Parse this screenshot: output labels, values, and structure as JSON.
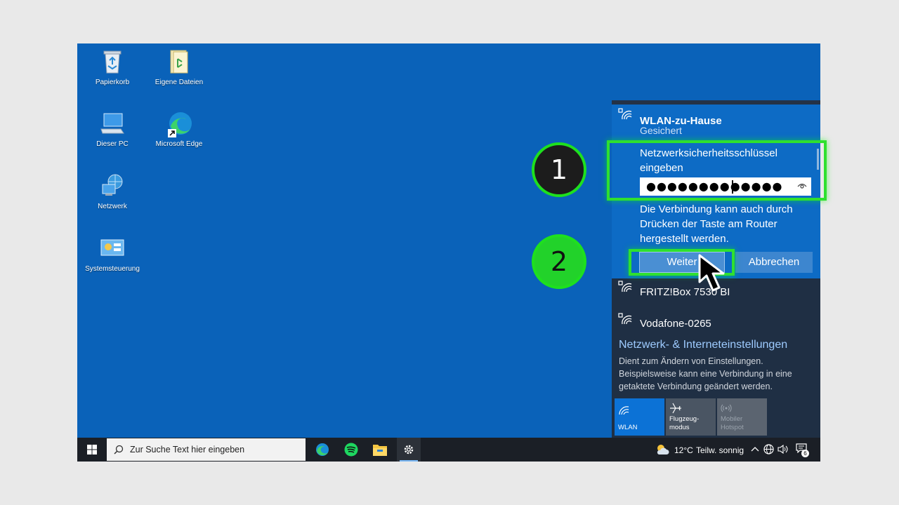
{
  "desktop": {
    "icons": [
      {
        "label": "Papierkorb",
        "icon": "recycle-bin-icon"
      },
      {
        "label": "Eigene Dateien",
        "icon": "user-folder-icon"
      },
      {
        "label": "Dieser PC",
        "icon": "computer-icon"
      },
      {
        "label": "Microsoft Edge",
        "icon": "edge-icon"
      },
      {
        "label": "Netzwerk",
        "icon": "network-icon"
      },
      {
        "label": "Systemsteuerung",
        "icon": "control-panel-icon"
      }
    ]
  },
  "flyout": {
    "selected": {
      "name": "WLAN-zu-Hause",
      "status": "Gesichert",
      "prompt_line1": "Netzwerksicherheitsschlüssel",
      "prompt_line2": "eingeben",
      "password_mask": "●●●●●●●●●●●●●",
      "wps_line1": "Die Verbindung kann auch durch",
      "wps_line2": "Drücken der Taste am Router",
      "wps_line3": "hergestellt werden.",
      "next_label": "Weiter",
      "cancel_label": "Abbrechen"
    },
    "networks": [
      "FRITZ!Box 7530 BI",
      "Vodafone-0265"
    ],
    "settings_title": "Netzwerk- & Interneteinstellungen",
    "settings_desc_1": "Dient zum Ändern von Einstellungen.",
    "settings_desc_2": "Beispielsweise kann eine Verbindung in eine",
    "settings_desc_3": "getaktete Verbindung geändert werden.",
    "tiles": [
      {
        "line1": "WLAN",
        "line2": "",
        "active": true
      },
      {
        "line1": "Flugzeug-",
        "line2": "modus",
        "active": false
      },
      {
        "line1": "Mobiler",
        "line2": "Hotspot",
        "active": false
      }
    ]
  },
  "annotations": {
    "step1": "1",
    "step2": "2"
  },
  "taskbar": {
    "search_placeholder": "Zur Suche Text hier eingeben",
    "weather_temp": "12°C",
    "weather_desc": "Teilw. sonnig",
    "notification_count": "6"
  },
  "colors": {
    "desktop": "#0a62b9",
    "flyout": "#1f2f44",
    "selected_network": "#0d6bc5",
    "highlight_green": "#2fe02f",
    "taskbar": "#1b1f26"
  }
}
